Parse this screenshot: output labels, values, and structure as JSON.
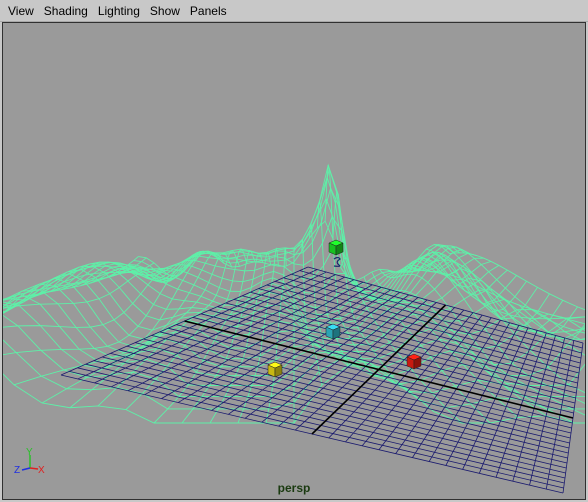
{
  "menu": {
    "items": [
      {
        "name": "menu-view",
        "label": "View"
      },
      {
        "name": "menu-shading",
        "label": "Shading"
      },
      {
        "name": "menu-lighting",
        "label": "Lighting"
      },
      {
        "name": "menu-show",
        "label": "Show"
      },
      {
        "name": "menu-panels",
        "label": "Panels"
      }
    ]
  },
  "viewport": {
    "camera_label": "persp",
    "colors": {
      "background": "#9a9a9a",
      "terrain_wireframe": "#5ef0a8",
      "ground_grid": "#1a1a6e",
      "grid_axis": "#000000"
    },
    "objects": [
      {
        "name": "green-cube",
        "color": "#18c020"
      },
      {
        "name": "cyan-cube",
        "color": "#2aa4b4"
      },
      {
        "name": "yellow-cube",
        "color": "#c8b812"
      },
      {
        "name": "red-cube",
        "color": "#c81a10"
      }
    ],
    "axis_indicator": {
      "x": "X",
      "y": "Y",
      "z": "Z"
    }
  }
}
